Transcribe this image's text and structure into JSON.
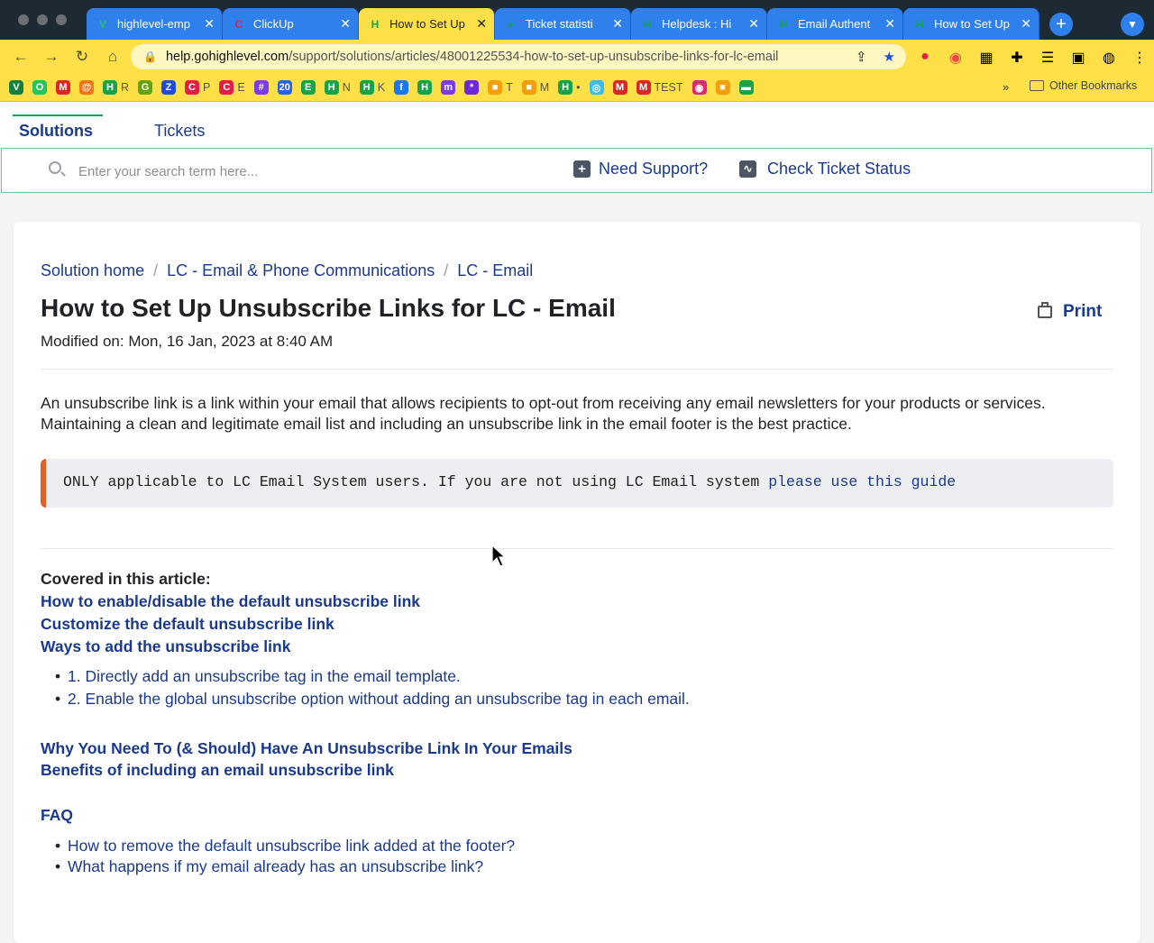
{
  "browser": {
    "tabs": [
      {
        "label": "highlevel-emp",
        "icon": "V",
        "color": "#22c55e",
        "active": false
      },
      {
        "label": "ClickUp",
        "icon": "C",
        "color": "#e11d48",
        "active": false
      },
      {
        "label": "How to Set Up",
        "icon": "H",
        "color": "#16a34a",
        "active": true
      },
      {
        "label": "Ticket statisti",
        "icon": "+",
        "color": "#16a34a",
        "active": false
      },
      {
        "label": "Helpdesk : Hi",
        "icon": "H",
        "color": "#16a34a",
        "active": false
      },
      {
        "label": "Email Authent",
        "icon": "H",
        "color": "#16a34a",
        "active": false
      },
      {
        "label": "How to Set Up",
        "icon": "H",
        "color": "#16a34a",
        "active": false
      }
    ],
    "url_domain": "help.gohighlevel.com",
    "url_path": "/support/solutions/articles/48001225534-how-to-set-up-unsubscribe-links-for-lc-email",
    "bookmarks": [
      {
        "icon": "V",
        "label": "",
        "color": "#15803d"
      },
      {
        "icon": "O",
        "label": "",
        "color": "#22c55e"
      },
      {
        "icon": "M",
        "label": "",
        "color": "#dc2626"
      },
      {
        "icon": "@",
        "label": "",
        "color": "#f97316"
      },
      {
        "icon": "H",
        "label": "R",
        "color": "#16a34a"
      },
      {
        "icon": "G",
        "label": "",
        "color": "#65a30d"
      },
      {
        "icon": "Z",
        "label": "",
        "color": "#1d4ed8"
      },
      {
        "icon": "C",
        "label": "P",
        "color": "#e11d48"
      },
      {
        "icon": "C",
        "label": "E",
        "color": "#e11d48"
      },
      {
        "icon": "#",
        "label": "",
        "color": "#7c3aed"
      },
      {
        "icon": "20",
        "label": "",
        "color": "#2563eb"
      },
      {
        "icon": "E",
        "label": "",
        "color": "#16a34a"
      },
      {
        "icon": "H",
        "label": "N",
        "color": "#16a34a"
      },
      {
        "icon": "H",
        "label": "K",
        "color": "#16a34a"
      },
      {
        "icon": "f",
        "label": "",
        "color": "#1877f2"
      },
      {
        "icon": "H",
        "label": "",
        "color": "#16a34a"
      },
      {
        "icon": "m",
        "label": "",
        "color": "#7c3aed"
      },
      {
        "icon": "*",
        "label": "",
        "color": "#6d28d9"
      },
      {
        "icon": "■",
        "label": "T",
        "color": "#f59e0b"
      },
      {
        "icon": "■",
        "label": "M",
        "color": "#f59e0b"
      },
      {
        "icon": "H",
        "label": "•",
        "color": "#16a34a"
      },
      {
        "icon": "◎",
        "label": "",
        "color": "#38bdf8"
      },
      {
        "icon": "M",
        "label": "",
        "color": "#dc2626"
      },
      {
        "icon": "M",
        "label": "TEST",
        "color": "#dc2626"
      },
      {
        "icon": "◉",
        "label": "",
        "color": "#db2777"
      },
      {
        "icon": "■",
        "label": "",
        "color": "#f59e0b"
      },
      {
        "icon": "▬",
        "label": "",
        "color": "#16a34a"
      }
    ],
    "more_bookmarks": "»",
    "other_bookmarks": "Other Bookmarks"
  },
  "portal": {
    "tabs": {
      "solutions": "Solutions",
      "tickets": "Tickets"
    },
    "search_placeholder": "Enter your search term here...",
    "need_support": "Need Support?",
    "check_status": "Check Ticket Status"
  },
  "article": {
    "breadcrumbs": [
      "Solution home",
      "LC - Email & Phone Communications",
      "LC - Email"
    ],
    "title": "How to Set Up Unsubscribe Links for LC - Email",
    "modified": "Modified on: Mon, 16 Jan, 2023 at 8:40 AM",
    "print_label": "Print",
    "intro": "An unsubscribe link is a link within your email that allows recipients to opt-out from receiving any email newsletters for your products or services. Maintaining a clean and legitimate email list and including an unsubscribe link in the email footer is the best practice.",
    "note_text": "ONLY applicable to LC Email System users. If you are not using LC Email system ",
    "note_link": "please use this guide",
    "covered_heading": "Covered in this article:",
    "toc": [
      "How to enable/disable the default unsubscribe link",
      "Customize the default unsubscribe link",
      "Ways to add the unsubscribe link"
    ],
    "toc_sub": [
      "1. Directly add an unsubscribe tag in the email template.",
      "2. Enable the global unsubscribe option without adding an unsubscribe tag in each email."
    ],
    "toc2": [
      "Why You Need To (& Should) Have An Unsubscribe Link In Your Emails",
      "Benefits of including an email unsubscribe link"
    ],
    "faq_heading": "FAQ",
    "faq": [
      "How to remove the default unsubscribe link added at the footer?",
      "What happens if my email already has an unsubscribe link?"
    ]
  },
  "colors": {
    "accent_link": "#1a3a8f",
    "note_border": "#e25f2a",
    "active_tab_underline": "#16a34a"
  }
}
